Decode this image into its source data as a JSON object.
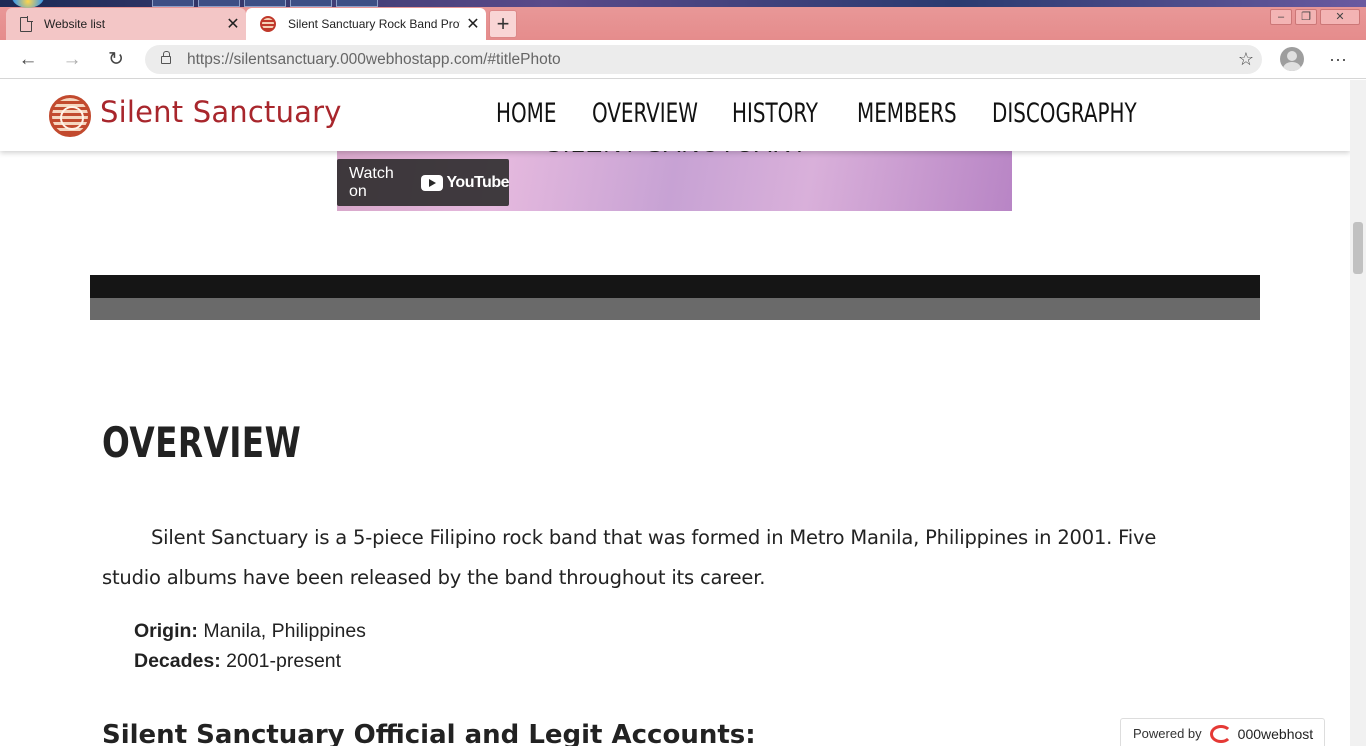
{
  "browser": {
    "tabs": [
      {
        "title": "Website list",
        "active": false
      },
      {
        "title": "Silent Sanctuary Rock Band Profi",
        "active": true
      }
    ],
    "new_tab_symbol": "+",
    "close_symbol": "✕",
    "window_controls": [
      "–",
      "❐",
      "✕"
    ],
    "url_host": "https://silentsanctuary.000webhostapp.com/",
    "url_rest": "#titlePhoto",
    "nav_icons": [
      "back-icon",
      "forward-icon",
      "reload-icon"
    ],
    "back_symbol": "←",
    "forward_symbol": "→",
    "reload_symbol": "↻",
    "favorite_symbol": "☆",
    "menu_symbol": "···"
  },
  "site": {
    "logo_text": "Silent Sanctuary",
    "nav": [
      "HOME",
      "OVERVIEW",
      "HISTORY",
      "MEMBERS",
      "DISCOGRAPHY"
    ]
  },
  "video": {
    "title_fragment": "SILENT SANCTUARY",
    "watch_on": "Watch on",
    "youtube": "YouTube"
  },
  "overview": {
    "heading": "OVERVIEW",
    "paragraph": "Silent Sanctuary is a 5-piece Filipino rock band that was formed in Metro Manila, Philippines in 2001. Five studio albums have been released by the band throughout its career.",
    "origin_label": "Origin:",
    "origin_value": "Manila, Philippines",
    "decades_label": "Decades:",
    "decades_value": "2001-present",
    "accounts_heading": "Silent Sanctuary Official and Legit Accounts:"
  },
  "footer_badge": {
    "powered_by": "Powered by",
    "brand": "000webhost"
  },
  "colors": {
    "tabstrip": "#e99a9a",
    "brand_red": "#a8262c",
    "dark_band": "#151515",
    "grey_band": "#6a6a6a"
  }
}
